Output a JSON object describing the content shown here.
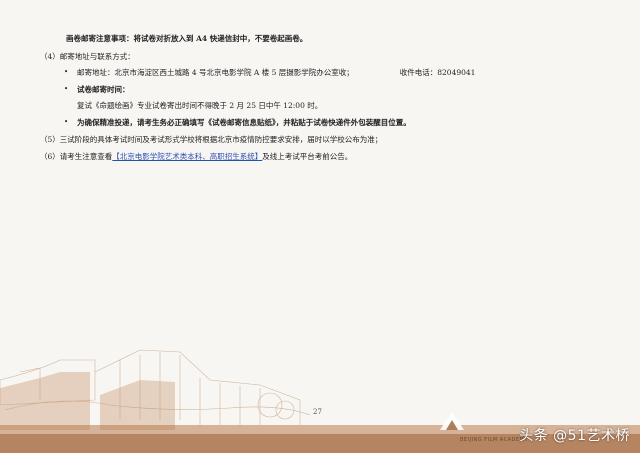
{
  "lines": {
    "l1": "画卷邮寄注意事项：将试卷对折放入到 A4 快递信封中，不要卷起画卷。",
    "l2": "（4）邮寄地址与联系方式：",
    "l3_addr": "邮寄地址：北京市海淀区西土城路 4 号北京电影学院 A 楼 5 层摄影学院办公室收；",
    "l3_phone": "收件电话：82049041",
    "l4": "试卷邮寄时间：",
    "l5": "复试《命题绘画》专业试卷寄出时间不得晚于 2 月 25 日中午 12:00 时。",
    "l6": "为确保精准投递，请考生务必正确填写《试卷邮寄信息贴纸》，并粘贴于试卷快递件外包装醒目位置。",
    "l7": "（5）三试阶段的具体考试时间及考试形式学校将根据北京市疫情防控要求安排，届时以学校公布为准；",
    "l8_pre": "（6）请考生注意查看",
    "l8_link": "【北京电影学院艺术类本科、高职招生系统】",
    "l8_post": "及线上考试平台考前公告。"
  },
  "page_number": "27",
  "logo_text": "BEIJING FILM ACADEMY",
  "watermark": "头条 @51艺术桥",
  "colors": {
    "link": "#2a4fb3",
    "footer_brown": "#a0673a",
    "background": "#f8f6f3"
  }
}
